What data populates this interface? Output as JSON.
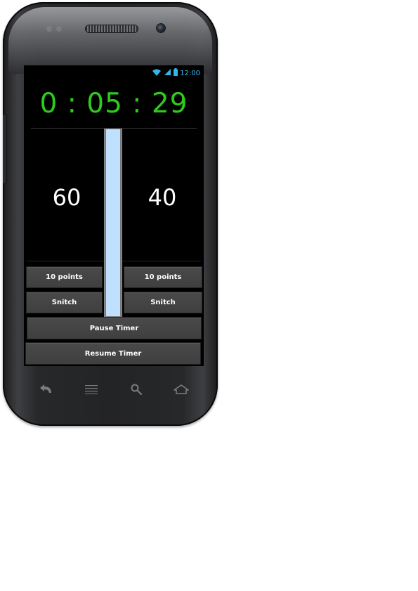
{
  "status_bar": {
    "time": "12:00",
    "icons": [
      "wifi-icon",
      "signal-icon",
      "battery-icon"
    ],
    "accent": "#33b5e5"
  },
  "timer": {
    "text": "0 : 05 : 29",
    "color": "#2ecc1a"
  },
  "scores": {
    "left": "60",
    "right": "40"
  },
  "progress": {
    "fraction": 1.0,
    "fill_color": "#bfe0ff"
  },
  "buttons": {
    "left_points": "10 points",
    "right_points": "10 points",
    "left_snitch": "Snitch",
    "right_snitch": "Snitch",
    "pause": "Pause Timer",
    "resume": "Resume Timer"
  },
  "nav": {
    "icons": [
      "back-icon",
      "menu-icon",
      "search-icon",
      "home-icon"
    ]
  }
}
